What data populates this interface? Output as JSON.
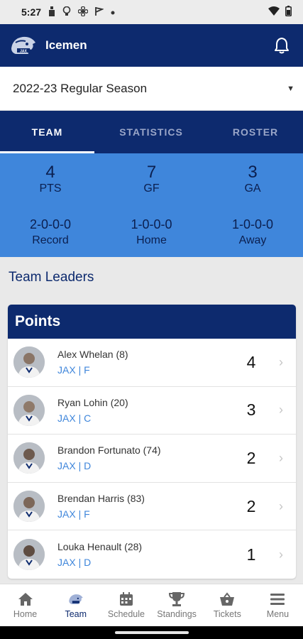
{
  "status": {
    "time": "5:27"
  },
  "header": {
    "title": "Icemen"
  },
  "season": {
    "selected": "2022-23 Regular Season"
  },
  "tabs": [
    {
      "label": "TEAM"
    },
    {
      "label": "STATISTICS"
    },
    {
      "label": "ROSTER"
    }
  ],
  "stats": [
    {
      "value": "4",
      "label": "PTS"
    },
    {
      "value": "7",
      "label": "GF"
    },
    {
      "value": "3",
      "label": "GA"
    },
    {
      "value": "2-0-0-0",
      "label": "Record"
    },
    {
      "value": "1-0-0-0",
      "label": "Home"
    },
    {
      "value": "1-0-0-0",
      "label": "Away"
    }
  ],
  "section": {
    "title": "Team Leaders"
  },
  "leaders": {
    "title": "Points",
    "players": [
      {
        "name": "Alex Whelan (8)",
        "meta": "JAX | F",
        "value": "4"
      },
      {
        "name": "Ryan Lohin (20)",
        "meta": "JAX | C",
        "value": "3"
      },
      {
        "name": "Brandon Fortunato (74)",
        "meta": "JAX | D",
        "value": "2"
      },
      {
        "name": "Brendan Harris (83)",
        "meta": "JAX | F",
        "value": "2"
      },
      {
        "name": "Louka Henault (28)",
        "meta": "JAX | D",
        "value": "1"
      }
    ]
  },
  "nav": [
    {
      "label": "Home",
      "icon": "home-icon"
    },
    {
      "label": "Team",
      "icon": "team-logo-icon"
    },
    {
      "label": "Schedule",
      "icon": "calendar-icon"
    },
    {
      "label": "Standings",
      "icon": "trophy-icon"
    },
    {
      "label": "Tickets",
      "icon": "basket-icon"
    },
    {
      "label": "Menu",
      "icon": "menu-icon"
    }
  ],
  "colors": {
    "navy": "#0d2a6e",
    "blue": "#3f86db",
    "link": "#3f86db"
  }
}
